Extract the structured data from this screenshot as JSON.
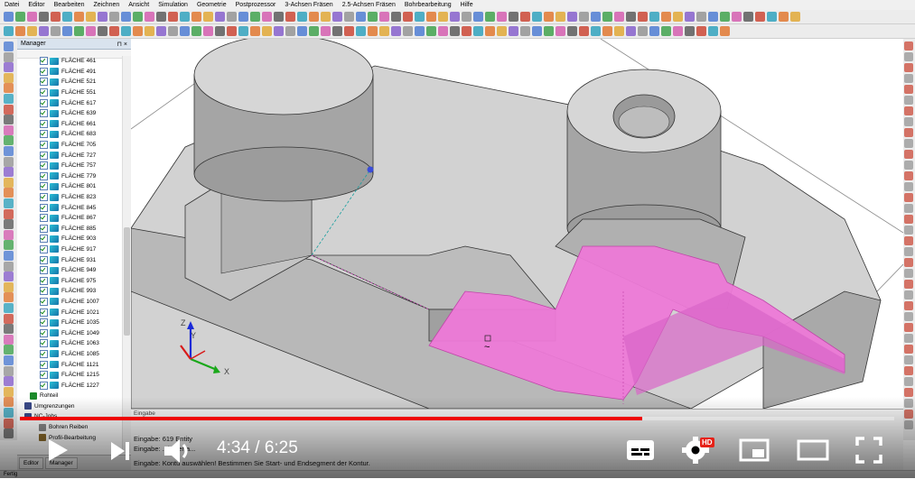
{
  "menu": [
    "Datei",
    "Editor",
    "Bearbeiten",
    "Zeichnen",
    "Ansicht",
    "Simulation",
    "Geometrie",
    "Postprozessor",
    "3-Achsen Fräsen",
    "2.5-Achsen Fräsen",
    "Bohrbearbeitung",
    "Hilfe"
  ],
  "manager": {
    "title": "Manager",
    "pin": "⊓ ×",
    "faces": [
      "FLÄCHE 461",
      "FLÄCHE 491",
      "FLÄCHE 521",
      "FLÄCHE 551",
      "FLÄCHE 617",
      "FLÄCHE 639",
      "FLÄCHE 661",
      "FLÄCHE 683",
      "FLÄCHE 705",
      "FLÄCHE 727",
      "FLÄCHE 757",
      "FLÄCHE 779",
      "FLÄCHE 801",
      "FLÄCHE 823",
      "FLÄCHE 845",
      "FLÄCHE 867",
      "FLÄCHE 885",
      "FLÄCHE 903",
      "FLÄCHE 917",
      "FLÄCHE 931",
      "FLÄCHE 949",
      "FLÄCHE 975",
      "FLÄCHE 993",
      "FLÄCHE 1007",
      "FLÄCHE 1021",
      "FLÄCHE 1035",
      "FLÄCHE 1049",
      "FLÄCHE 1063",
      "FLÄCHE 1085",
      "FLÄCHE 1121",
      "FLÄCHE 1215",
      "FLÄCHE 1227"
    ],
    "tree_items": [
      "Rohteil",
      "Umgrenzungen",
      "NC-Jobs",
      "Bohren Reiben",
      "Profil-Bearbeitung"
    ],
    "tabs": [
      "Editor",
      "Manager"
    ]
  },
  "command": {
    "label": "Eingabe",
    "lines": [
      "Eingabe: 619 Entity",
      "Eingabe: ...kalierfa...",
      "Eingabe: Kontu auswählen! Bestimmen Sie Start- und Endsegment der Kontur."
    ]
  },
  "status": "Fertig",
  "axes": {
    "z": "Z",
    "y": "Y",
    "x": "X"
  },
  "cursor_symbol": "~",
  "video": {
    "current": "4:34",
    "duration": "6:25",
    "progress_fraction": 0.712,
    "hd_badge": "HD"
  },
  "colors": {
    "pink": "#ee7ad8",
    "gray": "#c8c8c8",
    "red": "#ee0000"
  }
}
